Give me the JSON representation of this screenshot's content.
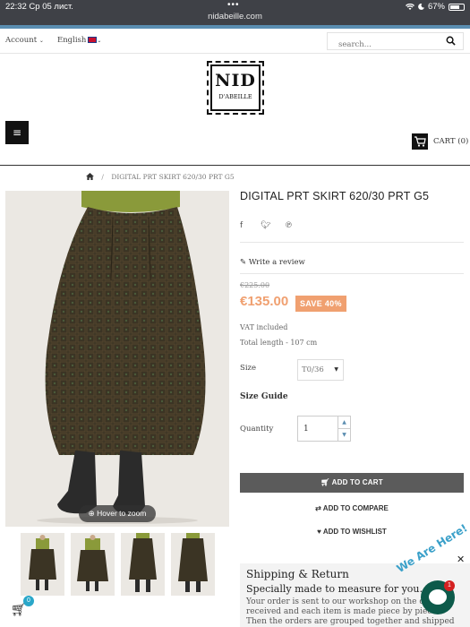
{
  "status_bar": {
    "time": "22:32",
    "date": "Ср 05 лист.",
    "dots": "•••",
    "url": "nidabeille.com",
    "battery": "67%"
  },
  "top_nav": {
    "account": "Account",
    "language": "English"
  },
  "search": {
    "placeholder": "search..."
  },
  "logo": {
    "line1": "NID",
    "line2": "D'ABEILLE"
  },
  "menu_icon": "≡",
  "cart": {
    "label": "CART (0)"
  },
  "breadcrumb": {
    "current": "DIGITAL PRT SKIRT 620/30 PRT G5"
  },
  "product": {
    "title": "DIGITAL PRT SKIRT 620/30 PRT G5",
    "write_review": "Write a review",
    "old_price": "€225.00",
    "price": "€135.00",
    "save_badge": "SAVE 40%",
    "vat": "VAT included",
    "length": "Total length - 107 cm",
    "size_label": "Size",
    "size_value": "T0/36",
    "size_guide": "Size Guide",
    "quantity_label": "Quantity",
    "quantity_value": "1",
    "add_to_cart": "ADD TO CART",
    "add_to_compare": "ADD TO COMPARE",
    "add_to_wishlist": "ADD TO WISHLIST",
    "hover_zoom": "Hover to zoom"
  },
  "shipping": {
    "heading": "Shipping & Return",
    "subheading": "Specially made to measure for you...",
    "body1": "Your order is sent to our workshop on the day it is",
    "body2": "received and each item is made piece by piece.",
    "body3": "Then the orders are grouped together and shipped to"
  },
  "chat": {
    "label": "We Are Here!",
    "badge": "1"
  },
  "bottom_cart": {
    "badge": "0"
  },
  "colors": {
    "accent_blue": "#5a8db0",
    "price_orange": "#f0a070",
    "button_gray": "#5b5b5b",
    "chat_green": "#0d5a4a"
  }
}
